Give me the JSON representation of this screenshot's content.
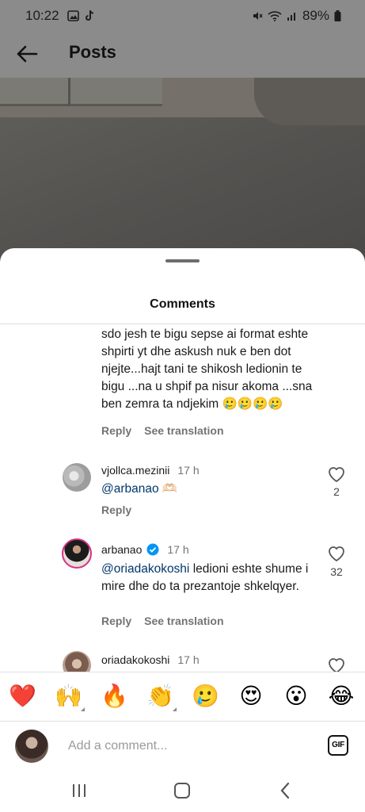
{
  "status_bar": {
    "time": "10:22",
    "battery": "89%"
  },
  "header": {
    "title": "Posts"
  },
  "sheet": {
    "title": "Comments"
  },
  "comments": [
    {
      "text": "sdo jesh te bigu sepse ai format eshte shpirti yt dhe askush nuk e ben dot njejte...hajt tani te shikosh ledionin te bigu ...na u shpif pa nisur akoma ...sna ben zemra ta ndjekim 🥲🥲🥲🥲",
      "reply": "Reply",
      "see_translation": "See translation"
    },
    {
      "username": "vjollca.mezinii",
      "time": "17 h",
      "mention": "@arbanao",
      "text": " 🫶🏻",
      "reply": "Reply",
      "likes": "2"
    },
    {
      "username": "arbanao",
      "verified": true,
      "time": "17 h",
      "mention": "@oriadakokoshi",
      "text": " ledioni eshte shume i mire dhe do ta prezantoje shkelqyer.",
      "reply": "Reply",
      "see_translation": "See translation",
      "likes": "32"
    },
    {
      "username": "oriadakokoshi",
      "time": "17 h"
    }
  ],
  "emoji_bar": [
    "❤️",
    "🙌",
    "🔥",
    "👏",
    "🥲",
    "😍",
    "😮",
    "😂"
  ],
  "input": {
    "placeholder": "Add a comment...",
    "gif_label": "GIF"
  },
  "colors": {
    "mention": "#00376b",
    "verified": "#0095f6",
    "meta": "#737373"
  }
}
